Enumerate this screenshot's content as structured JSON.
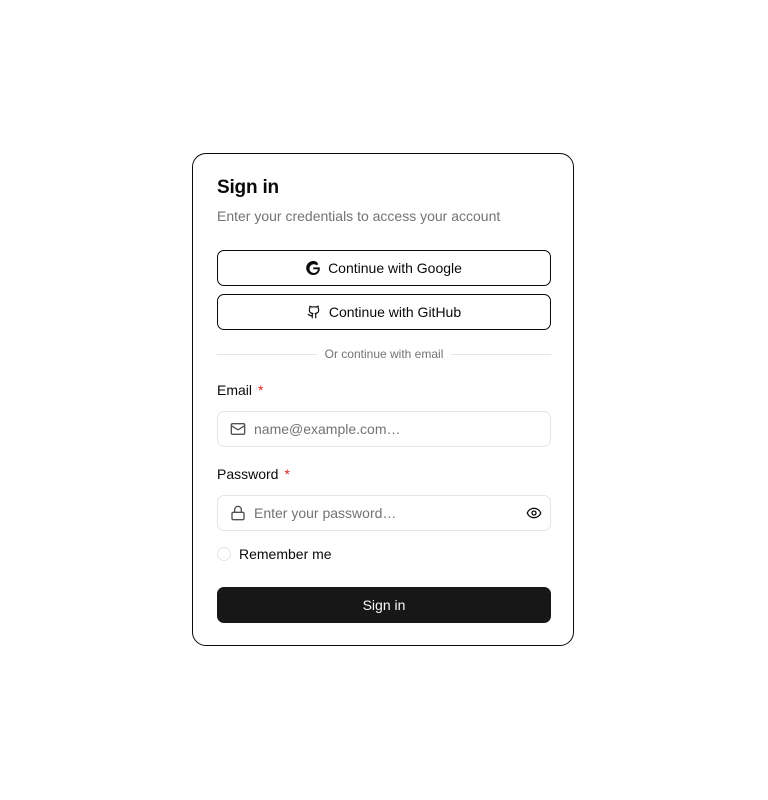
{
  "card": {
    "title": "Sign in",
    "subtitle": "Enter your credentials to access your account"
  },
  "oauth": {
    "google": {
      "label": "Continue with Google",
      "icon": "google-icon"
    },
    "github": {
      "label": "Continue with GitHub",
      "icon": "github-icon"
    }
  },
  "divider": {
    "text": "Or continue with email"
  },
  "email": {
    "label": "Email",
    "required_mark": "*",
    "placeholder": "name@example.com…",
    "value": "",
    "icon": "mail-icon"
  },
  "password": {
    "label": "Password",
    "required_mark": "*",
    "placeholder": "Enter your password…",
    "value": "",
    "icon": "lock-icon",
    "toggle_icon": "eye-icon"
  },
  "remember": {
    "label": "Remember me",
    "checked": false
  },
  "submit": {
    "label": "Sign in"
  },
  "colors": {
    "primary": "#171717",
    "required": "#dc2626",
    "muted_text": "#737373",
    "border": "#e5e5e5"
  }
}
